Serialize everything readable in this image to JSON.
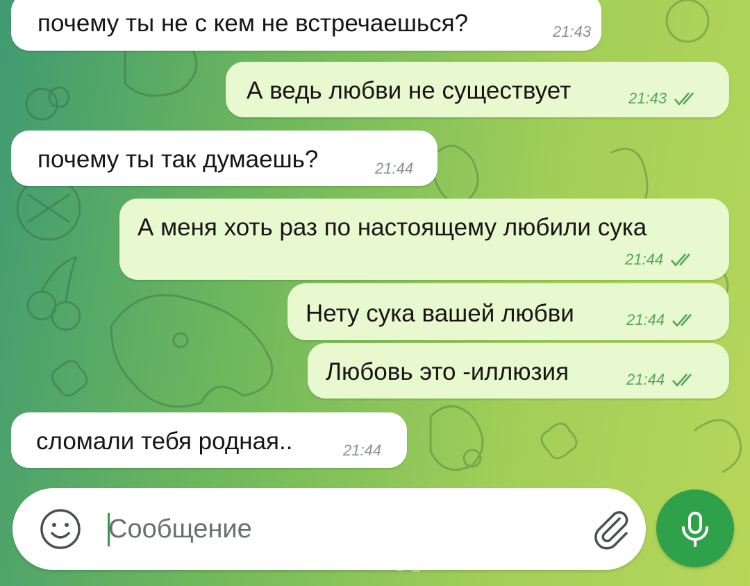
{
  "chat": {
    "messages": [
      {
        "direction": "incoming",
        "text": "почему ты не с кем не встречаешься?",
        "time": "21:43"
      },
      {
        "direction": "outgoing",
        "text": "А ведь любви не существует",
        "time": "21:43",
        "status": "read"
      },
      {
        "direction": "incoming",
        "text": "почему ты так думаешь?",
        "time": "21:44"
      },
      {
        "direction": "outgoing",
        "text": "А меня хоть раз по настоящему любили сука",
        "time": "21:44",
        "status": "read"
      },
      {
        "direction": "outgoing",
        "text": "Нету сука вашей любви",
        "time": "21:44",
        "status": "read"
      },
      {
        "direction": "outgoing",
        "text": "Любовь это -иллюзия",
        "time": "21:44",
        "status": "read"
      },
      {
        "direction": "incoming",
        "text": "сломали тебя родная..",
        "time": "21:44"
      }
    ]
  },
  "composer": {
    "placeholder": "Сообщение",
    "value": "",
    "emoji_icon": "smile-icon",
    "attach_icon": "paperclip-icon",
    "mic_icon": "microphone-icon"
  },
  "watermark": {
    "text": "♪@general.mam"
  },
  "colors": {
    "incoming_bubble": "#ffffff",
    "outgoing_bubble": "#e8f8cf",
    "outgoing_meta": "#53a85a",
    "mic_button": "#2ea14a",
    "background_start": "#3f9a72",
    "background_end": "#b7d65a"
  }
}
